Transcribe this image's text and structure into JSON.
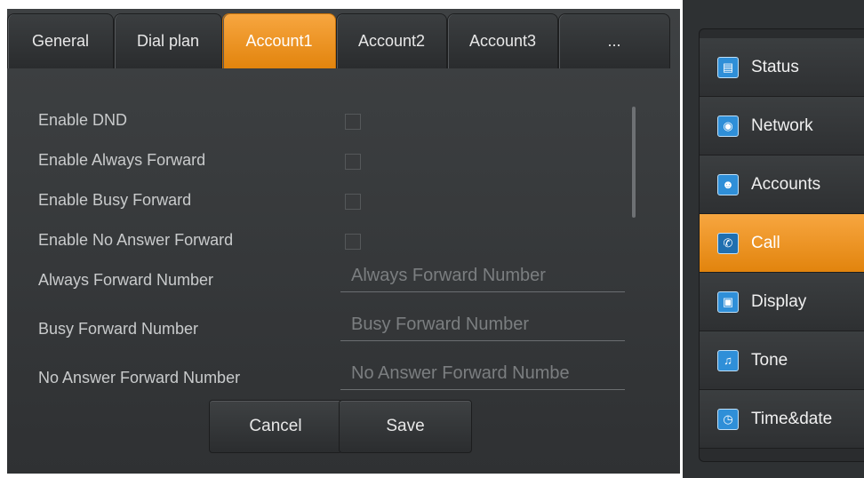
{
  "tabs": [
    {
      "label": "General"
    },
    {
      "label": "Dial plan"
    },
    {
      "label": "Account1"
    },
    {
      "label": "Account2"
    },
    {
      "label": "Account3"
    },
    {
      "label": "..."
    }
  ],
  "active_tab": "Account1",
  "form": {
    "checkboxes": [
      {
        "label": "Enable DND",
        "checked": false
      },
      {
        "label": "Enable Always Forward",
        "checked": false
      },
      {
        "label": "Enable Busy Forward",
        "checked": false
      },
      {
        "label": "Enable No Answer Forward",
        "checked": false
      }
    ],
    "fields": [
      {
        "label": "Always Forward Number",
        "placeholder": "Always Forward Number",
        "value": ""
      },
      {
        "label": "Busy Forward Number",
        "placeholder": "Busy Forward Number",
        "value": ""
      },
      {
        "label": "No Answer Forward Number",
        "placeholder": "No Answer Forward Numbe",
        "value": ""
      }
    ]
  },
  "buttons": {
    "cancel": "Cancel",
    "save": "Save"
  },
  "sidebar": {
    "items": [
      {
        "label": "Status",
        "icon": "status-icon"
      },
      {
        "label": "Network",
        "icon": "network-icon"
      },
      {
        "label": "Accounts",
        "icon": "accounts-icon"
      },
      {
        "label": "Call",
        "icon": "call-icon"
      },
      {
        "label": "Display",
        "icon": "display-icon"
      },
      {
        "label": "Tone",
        "icon": "tone-icon"
      },
      {
        "label": "Time&date",
        "icon": "clock-icon"
      }
    ],
    "active": "Call"
  },
  "colors": {
    "accent": "#f39a2a",
    "panel": "#36393b",
    "icon_blue": "#2f8fd8"
  }
}
